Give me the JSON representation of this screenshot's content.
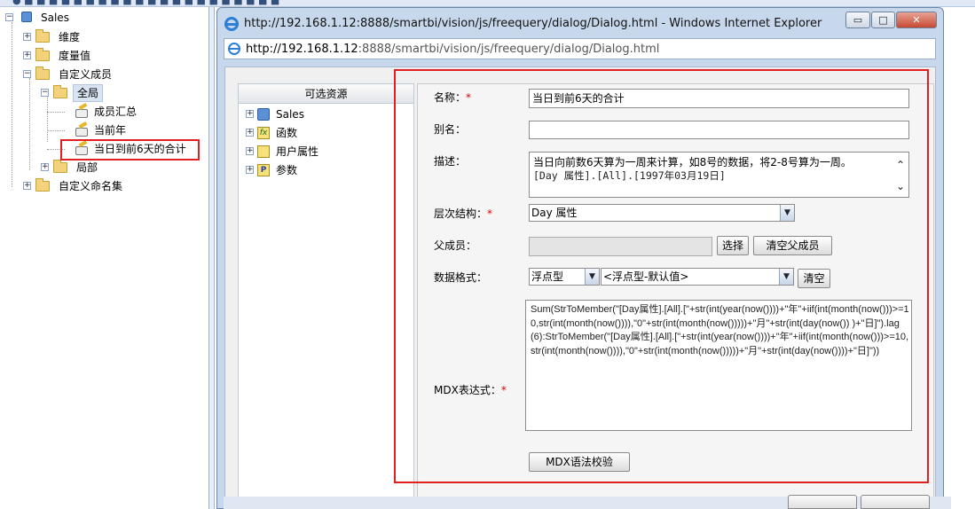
{
  "tree": {
    "root": "Sales",
    "dimension": "维度",
    "measure": "度量值",
    "custom_members": "自定义成员",
    "global": "全局",
    "member_summary": "成员汇总",
    "current_year": "当前年",
    "selected_member": "当日到前6天的合计",
    "local": "局部",
    "custom_named_sets": "自定义命名集"
  },
  "window": {
    "title": "http://192.168.1.12:8888/smartbi/vision/js/freequery/dialog/Dialog.html - Windows Internet Explorer",
    "address_host": "http://192.168.1.12",
    "address_rest": ":8888/smartbi/vision/js/freequery/dialog/Dialog.html",
    "minimize_glyph": "▭",
    "maximize_glyph": "□",
    "close_glyph": "✕"
  },
  "resources": {
    "header": "可选资源",
    "items": [
      "Sales",
      "函数",
      "用户属性",
      "参数"
    ]
  },
  "form": {
    "name_label": "名称：",
    "name_value": "当日到前6天的合计",
    "alias_label": "别名：",
    "alias_value": "",
    "desc_label": "描述：",
    "desc_line1": "当日向前数6天算为一周来计算，如8号的数据，将2-8号算为一周。",
    "desc_line2": "[Day 属性].[All].[1997年03月19日]",
    "hierarchy_label": "层次结构：",
    "hierarchy_value": "Day 属性",
    "parent_label": "父成员：",
    "parent_value": "",
    "select_button": "选择",
    "clear_parent_button": "清空父成员",
    "format_label": "数据格式：",
    "format_type": "浮点型",
    "format_value": "<浮点型-默认值>",
    "clear_button": "清空",
    "mdx_label": "MDX表达式：",
    "mdx_value": "Sum(StrToMember(\"[Day属性].[All].[\"+str(int(year(now())))+\"年\"+iif(int(month(now()))>=10,str(int(month(now()))),\"0\"+str(int(month(now()))))+\"月\"+str(int(day(now()) )+\"日]\").lag(6):StrToMember(\"[Day属性].[All].[\"+str(int(year(now())))+\"年\"+iif(int(month(now()))>=10,str(int(month(now()))),\"0\"+str(int(month(now()))))+\"月\"+str(int(day(now())))+\"日]\"))",
    "mdx_check_button": "MDX语法校验",
    "required_mark": "*"
  },
  "colors": {
    "highlight_red": "#e02020",
    "window_frame": "#c7d8ec"
  }
}
